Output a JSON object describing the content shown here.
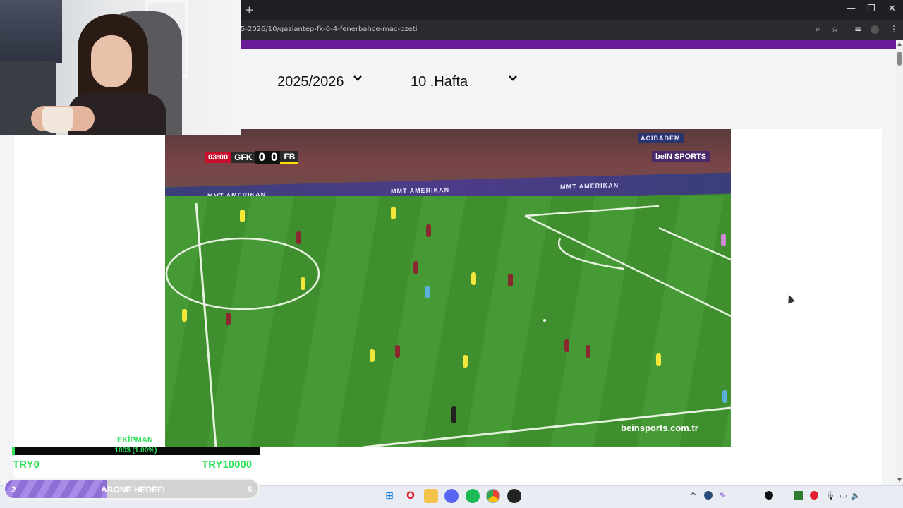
{
  "browser": {
    "new_tab_label": "+",
    "url": "5-2026/10/gaziantep-fk-0-4-fenerbahce-mac-ozeti",
    "window_controls": {
      "minimize": "—",
      "restore": "❐",
      "close": "✕"
    },
    "toolbar_icons": {
      "zoom": "⌕",
      "bookmark": "☆",
      "media": "≡",
      "menu": "⋮"
    }
  },
  "filters": {
    "season": "2025/2026",
    "week": "10 .Hafta"
  },
  "video": {
    "scoreboard": {
      "time": "03:00",
      "home_team": "GFK",
      "home_score": "0",
      "away_score": "0",
      "away_team": "FB"
    },
    "broadcaster_logo": "beIN SPORTS",
    "broadcaster_url": "beinsports.com.tr",
    "ad_text": "MMT AMERIKAN",
    "ad_text_2": "ACIBADEM"
  },
  "equipment_goal": {
    "label": "EKİPMAN",
    "progress_text": "100$ (1.00%)",
    "progress_fraction": 0.01,
    "min_label": "TRY0",
    "max_label": "TRY10000",
    "color": "#2fe35a"
  },
  "subscriber_goal": {
    "current": "2",
    "title": "ABONE HEDEFI",
    "target": "5",
    "progress_fraction": 0.4,
    "color": "#8f6fd6"
  },
  "colors": {
    "accent_strip": "#6a1b9a",
    "home_team": "#8a2830",
    "away_team": "#f5e63a"
  },
  "taskbar": {
    "apps": [
      "windows-icon",
      "opera-icon",
      "file-explorer-icon",
      "discord-icon",
      "spotify-icon",
      "chrome-icon",
      "obs-icon"
    ]
  }
}
